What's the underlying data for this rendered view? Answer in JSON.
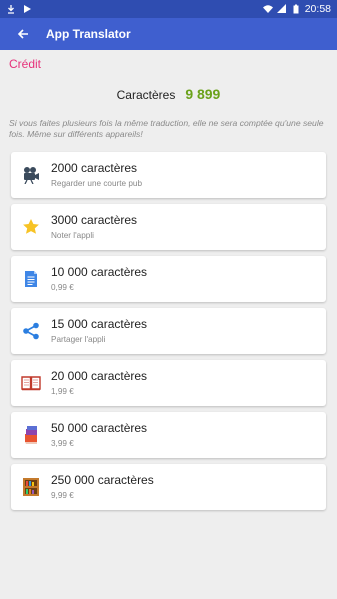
{
  "status_bar": {
    "time": "20:58"
  },
  "app_bar": {
    "title": "App Translator"
  },
  "page": {
    "heading": "Crédit",
    "balance_label": "Caractères",
    "balance_value": "9 899",
    "notice": "Si vous faites plusieurs fois la même traduction, elle ne sera comptée qu'une seule fois. Même sur différents appareils!"
  },
  "offers": [
    {
      "title": "2000 caractères",
      "subtitle": "Regarder une courte pub",
      "icon": "film-camera-icon"
    },
    {
      "title": "3000 caractères",
      "subtitle": "Noter l'appli",
      "icon": "star-icon"
    },
    {
      "title": "10 000 caractères",
      "subtitle": "0,99 €",
      "icon": "document-icon"
    },
    {
      "title": "15 000 caractères",
      "subtitle": "Partager l'appli",
      "icon": "share-icon"
    },
    {
      "title": "20 000 caractères",
      "subtitle": "1,99 €",
      "icon": "open-book-icon"
    },
    {
      "title": "50 000 caractères",
      "subtitle": "3,99 €",
      "icon": "books-icon"
    },
    {
      "title": "250 000 caractères",
      "subtitle": "9,99 €",
      "icon": "bookshelf-icon"
    }
  ],
  "colors": {
    "app_bar": "#3f5fcf",
    "status_bar": "#2f4db1",
    "heading": "#e6317a",
    "balance": "#6aa21a"
  }
}
